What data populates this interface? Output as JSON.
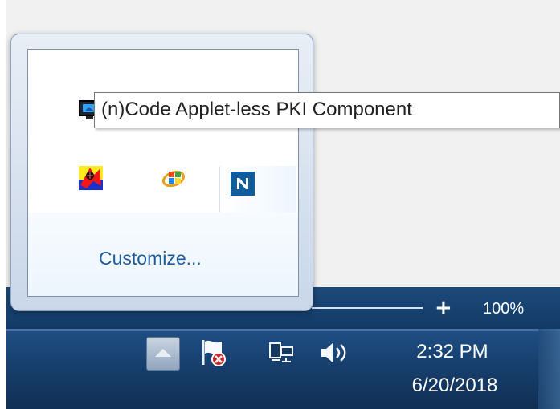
{
  "tooltip": {
    "text": "(n)Code Applet-less PKI Component"
  },
  "notification_overflow": {
    "customize_label": "Customize..."
  },
  "status_bar": {
    "zoom_value": "100%"
  },
  "taskbar": {
    "time": "2:32 PM",
    "date": "6/20/2018"
  },
  "icons": {
    "tray": [
      "monitor-app-icon",
      "pencil-app-icon",
      "orange-app-icon",
      "red-glyph-icon",
      "windows-ie-icon",
      "n-code-icon"
    ],
    "system": [
      "show-hidden-icons-icon",
      "action-center-flag-icon",
      "network-icon",
      "volume-icon"
    ]
  },
  "colors": {
    "taskbar": "#173f6d",
    "link": "#1d5d9c",
    "tooltip_background": "#ffffff",
    "popup_border": "#8ea3bf"
  }
}
